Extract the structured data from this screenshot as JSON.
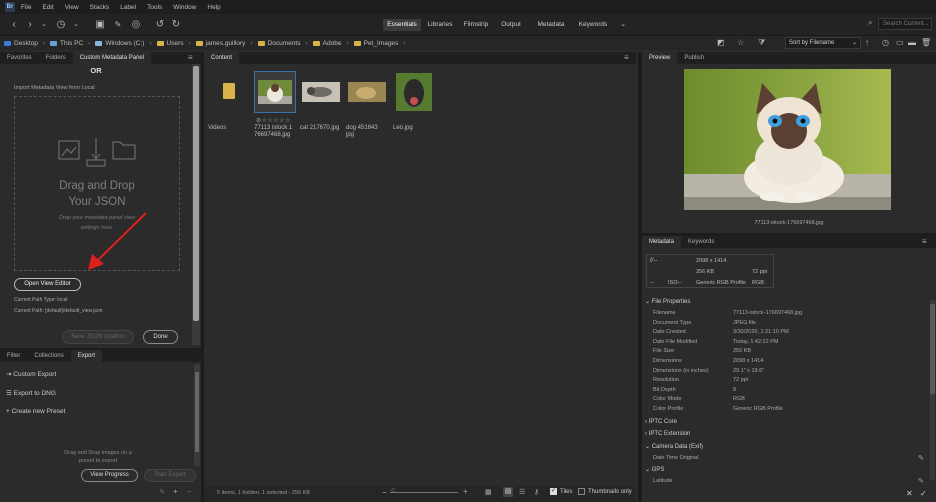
{
  "menubar": {
    "items": [
      "File",
      "Edit",
      "View",
      "Stacks",
      "Label",
      "Tools",
      "Window",
      "Help"
    ]
  },
  "workspaces": [
    {
      "label": "Essentials",
      "active": true
    },
    {
      "label": "Libraries",
      "active": false
    },
    {
      "label": "Filmstrip",
      "active": false
    },
    {
      "label": "Output",
      "active": false
    },
    {
      "label": "Metadata",
      "active": false
    },
    {
      "label": "Keywords",
      "active": false
    }
  ],
  "search_placeholder": "Search Current...",
  "path": [
    "Desktop",
    "This PC",
    "Windows (C:)",
    "Users",
    "james.guillory",
    "Documents",
    "Adobe",
    "Pet_Images"
  ],
  "sort_label": "Sort by Filename",
  "left_panel": {
    "tabs": [
      "Favorites",
      "Folders",
      "Custom Metadata Panel"
    ],
    "or_text": "OR",
    "import_text": "Import Metadata View from Local",
    "drag_title_1": "Drag and Drop",
    "drag_title_2": "Your JSON",
    "drag_sub_1": "Drop your metadata panel view",
    "drag_sub_2": "settings here.",
    "open_view_editor": "Open View Editor",
    "path_type": "Current Path Type: local",
    "path_value": "Current Path: [default]/default_view.json",
    "save_json": "Save JSON location",
    "done": "Done"
  },
  "lower_left": {
    "tabs": [
      "Filter",
      "Collections",
      "Export"
    ],
    "items": [
      "Custom Export",
      "Export to DNG",
      "Create new Preset"
    ],
    "drop_hint_1": "Drag and Drop images on a",
    "drop_hint_2": "preset to export",
    "view_progress": "View Progress",
    "start_export": "Start Export"
  },
  "content": {
    "tab": "Content",
    "items": [
      {
        "name": "Videos"
      },
      {
        "name": "77113 istock 1 76697468.jpg",
        "rating": "⊘☆☆☆☆☆"
      },
      {
        "name": "cat 217670.jpg"
      },
      {
        "name": "dog 451643 jpg"
      },
      {
        "name": "Leo.jpg"
      }
    ],
    "status": "5 items, 1 hidden, 1 selected - 256 KB",
    "tiles_label": "Tiles",
    "thumbs_only_label": "Thumbnails only"
  },
  "preview": {
    "tabs": [
      "Preview",
      "Publish"
    ],
    "caption": "77113-istock-176697468.jpg"
  },
  "metadata": {
    "tabs": [
      "Metadata",
      "Keywords"
    ],
    "summary": {
      "f_label": "f/--",
      "dims": "2098 x 1414",
      "size": "256 KB",
      "ppi": "72 ppi",
      "dash": "--",
      "iso": "ISO--",
      "profile": "Generic RGB Profile",
      "mode": "RGB"
    },
    "file_props_title": "File Properties",
    "rows": [
      {
        "k": "Filename",
        "v": "77113-istock-176697468.jpg"
      },
      {
        "k": "Document Type",
        "v": "JPEG file"
      },
      {
        "k": "Date Created",
        "v": "3/30/2020, 1:21:10 PM"
      },
      {
        "k": "Date File Modified",
        "v": "Today, 1:42:22 PM"
      },
      {
        "k": "File Size",
        "v": "256 KB"
      },
      {
        "k": "Dimensions",
        "v": "2098 x 1414"
      },
      {
        "k": "Dimensions (in inches)",
        "v": "29.1\" x 19.6\""
      },
      {
        "k": "Resolution",
        "v": "72 ppi"
      },
      {
        "k": "Bit Depth",
        "v": "8"
      },
      {
        "k": "Color Mode",
        "v": "RGB"
      },
      {
        "k": "Color Profile",
        "v": "Generic RGB Profile"
      }
    ],
    "sections": [
      "IPTC Core",
      "IPTC Extension",
      "Camera Data (Exif)",
      "GPS"
    ],
    "exif_row": "Date Time Original",
    "gps_row": "Latitude"
  },
  "colors": {
    "accent": "#2f8fe0",
    "arrow": "#e0201c",
    "folder": "#d9b24a"
  }
}
